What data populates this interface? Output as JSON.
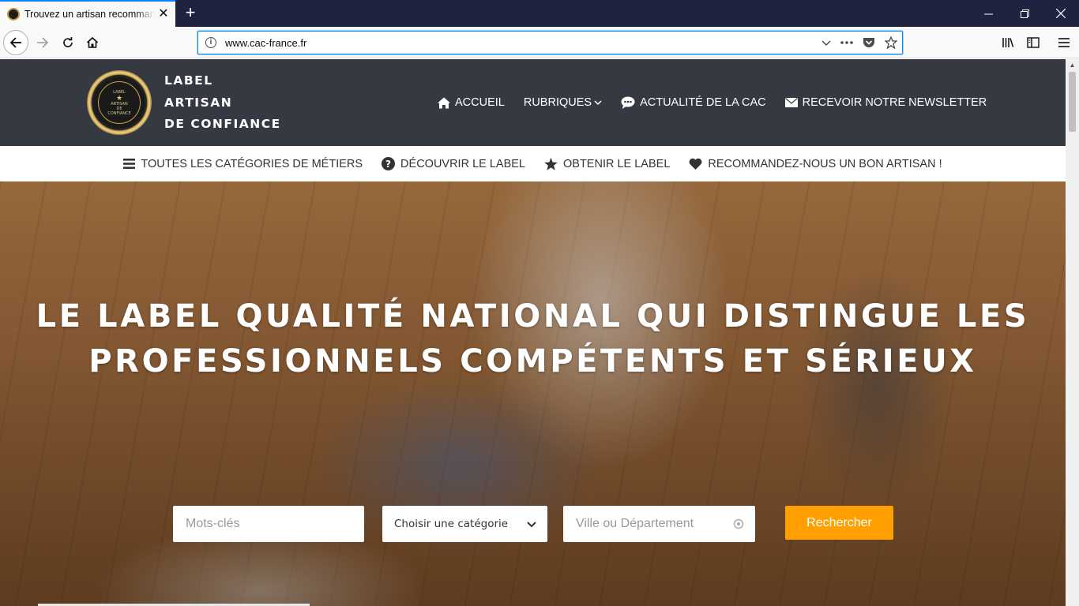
{
  "browser": {
    "tab_title": "Trouvez un artisan recommandé",
    "url": "www.cac-france.fr"
  },
  "site": {
    "logo_mini": [
      "LABEL",
      "ARTISAN",
      "DE",
      "CONFIANCE"
    ],
    "logo_text": [
      "LABEL",
      "ARTISAN",
      "DE CONFIANCE"
    ],
    "main_nav": [
      {
        "label": "ACCUEIL",
        "icon": "home-icon"
      },
      {
        "label": "RUBRIQUES",
        "icon": "chevron-down-icon"
      },
      {
        "label": "ACTUALITÉ DE LA CAC",
        "icon": "chat-bubble-icon"
      },
      {
        "label": "RECEVOIR NOTRE NEWSLETTER",
        "icon": "envelope-icon"
      }
    ],
    "sub_nav": [
      {
        "label": "TOUTES LES CATÉGORIES DE MÉTIERS",
        "icon": "bars-icon"
      },
      {
        "label": "DÉCOUVRIR LE LABEL",
        "icon": "question-circle-icon"
      },
      {
        "label": "OBTENIR LE LABEL",
        "icon": "star-icon"
      },
      {
        "label": "RECOMMANDEZ-NOUS UN BON ARTISAN !",
        "icon": "heart-icon"
      }
    ]
  },
  "hero": {
    "title_line1": "LE LABEL QUALITÉ NATIONAL QUI DISTINGUE LES",
    "title_line2": "PROFESSIONNELS COMPÉTENTS ET SÉRIEUX",
    "search": {
      "keyword_placeholder": "Mots-clés",
      "category_selected": "Choisir une catégorie",
      "city_placeholder": "Ville ou Département",
      "button_label": "Rechercher"
    }
  },
  "colors": {
    "header_bg": "#353a42",
    "accent_button": "#ff9f00",
    "browser_frame": "#202340",
    "focus_ring": "#0a84ff"
  }
}
